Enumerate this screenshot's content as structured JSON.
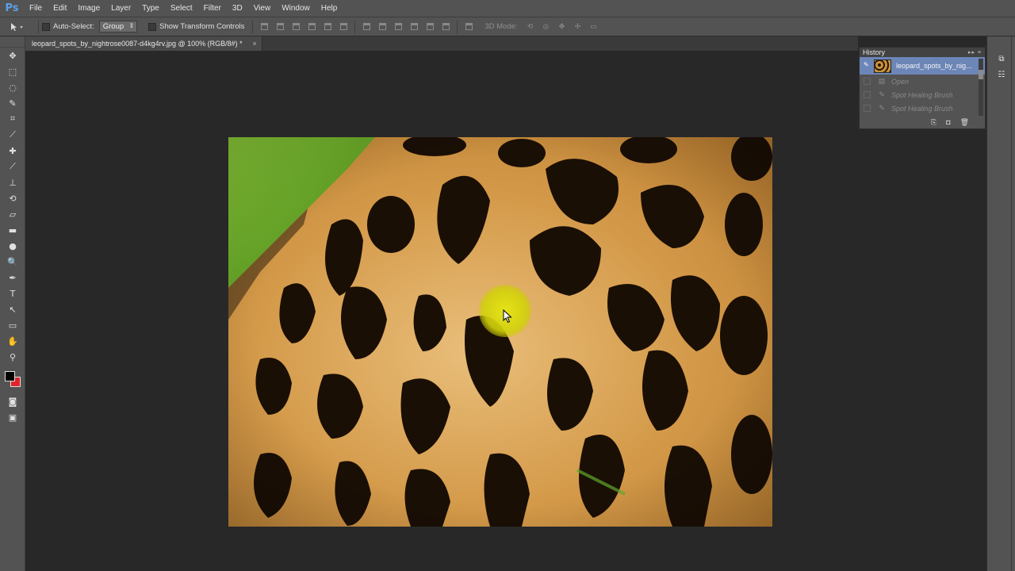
{
  "app": {
    "logo": "Ps"
  },
  "menu": [
    "File",
    "Edit",
    "Image",
    "Layer",
    "Type",
    "Select",
    "Filter",
    "3D",
    "View",
    "Window",
    "Help"
  ],
  "options": {
    "move_tool_icon": "move-arrow-icon",
    "auto_select_label": "Auto-Select:",
    "auto_select_checked": false,
    "auto_select_value": "Group",
    "show_transform_label": "Show Transform Controls",
    "show_transform_checked": false,
    "three_d_mode_label": "3D Mode:"
  },
  "document": {
    "tab_title": "leopard_spots_by_nightrose0087-d4kg4rv.jpg @ 100% (RGB/8#) *",
    "close_glyph": "×"
  },
  "tools": [
    "move-tool-icon",
    "marquee-tool-icon",
    "lasso-tool-icon",
    "quick-select-tool-icon",
    "crop-tool-icon",
    "eyedropper-tool-icon",
    "spot-healing-tool-icon",
    "brush-tool-icon",
    "clone-stamp-tool-icon",
    "history-brush-tool-icon",
    "eraser-tool-icon",
    "gradient-tool-icon",
    "blur-tool-icon",
    "dodge-tool-icon",
    "pen-tool-icon",
    "type-tool-icon",
    "path-select-tool-icon",
    "shape-tool-icon",
    "hand-tool-icon",
    "zoom-tool-icon"
  ],
  "tool_glyphs": [
    "✥",
    "⬚",
    "◌",
    "✎",
    "⌗",
    "⟋",
    "✚",
    "⟋",
    "⊥",
    "⟲",
    "▱",
    "▬",
    "●",
    "🔍",
    "✒",
    "T",
    "↖",
    "▭",
    "✋",
    "⚲"
  ],
  "colors": {
    "foreground": "#000000",
    "background": "#e0242b"
  },
  "history": {
    "title": "History",
    "snapshot_name": "leopard_spots_by_nig...",
    "states": [
      "Open",
      "Spot Healing Brush",
      "Spot Healing Brush"
    ]
  }
}
